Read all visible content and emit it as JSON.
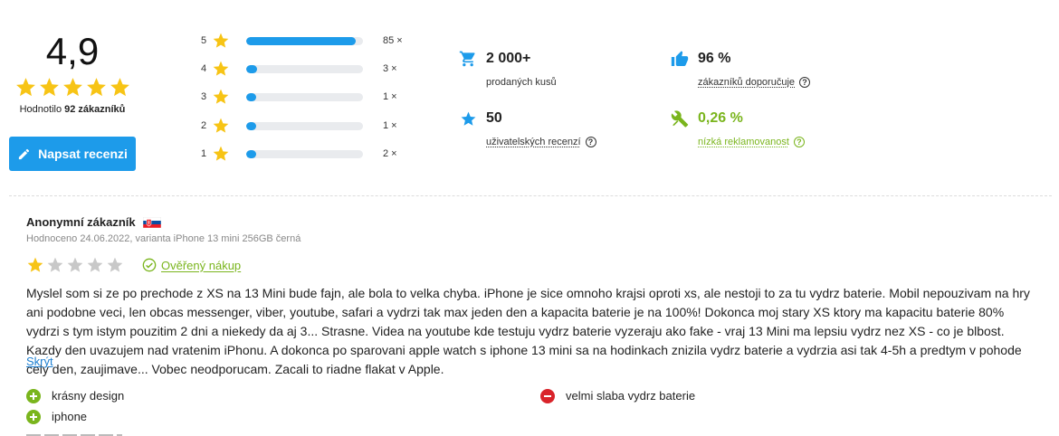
{
  "summary": {
    "score": "4,9",
    "stars_filled": 5,
    "caption_prefix": "Hodnotilo",
    "caption_count": "92 zákazníků",
    "write_button": "Napsat recenzi"
  },
  "histogram": [
    {
      "stars": "5",
      "fraction": 0.94,
      "count": "85 ×"
    },
    {
      "stars": "4",
      "fraction": 0.09,
      "count": "3 ×"
    },
    {
      "stars": "3",
      "fraction": 0.05,
      "count": "1 ×"
    },
    {
      "stars": "2",
      "fraction": 0.05,
      "count": "1 ×"
    },
    {
      "stars": "1",
      "fraction": 0.06,
      "count": "2 ×"
    }
  ],
  "stats": {
    "sold": {
      "value": "2 000+",
      "label": "prodaných kusů",
      "icon": "cart-icon"
    },
    "recommend": {
      "value": "96 %",
      "label": "zákazníků doporučuje",
      "icon": "thumbs-up-icon"
    },
    "reviews": {
      "value": "50",
      "label": "uživatelských recenzí",
      "icon": "star-icon"
    },
    "complaints": {
      "value": "0,26 %",
      "label": "nízká reklamovanost",
      "icon": "tools-icon"
    }
  },
  "review": {
    "author": "Anonymní zákazník",
    "country_flag": "slovakia-flag",
    "meta": "Hodnoceno 24.06.2022, varianta iPhone 13 mini 256GB černá",
    "rating": 1,
    "verified": "Ověřený nákup",
    "text": "Myslel som si ze po prechode z XS na 13 Mini bude fajn, ale bola to velka chyba. iPhone je sice omnoho krajsi oproti xs, ale nestoji to za tu vydrz baterie. Mobil nepouzivam na hry ani podobne veci, len obcas messenger, viber, youtube, safari a vydrzi tak max jeden den a kapacita baterie je na 100%! Dokonca moj stary XS ktory ma kapacitu baterie 80% vydrzi s tym istym pouzitim 2 dni a niekedy da aj 3... Strasne. Videa na youtube kde testuju vydrz baterie vyzeraju ako fake - vraj 13 Mini ma lepsiu vydrz nez XS - co je blbost. Kazdy den uvazujem nad vratenim iPhonu. A dokonca po sparovani apple watch s iphone 13 mini sa na hodinkach znizila vydrz baterie a vydrzia asi tak 4-5h a predtym v pohode cely den, zaujimave... Vobec neodporucam. Zacali to riadne flakat v Apple.",
    "collapse": "Skrýt",
    "pros": [
      "krásny design",
      "iphone"
    ],
    "cons": [
      "velmi slaba vydrz baterie"
    ]
  },
  "colors": {
    "accent": "#1d9bea",
    "star": "#f7c415",
    "star_empty": "#c8c8c8",
    "positive": "#7ab51d",
    "negative": "#d9232a"
  }
}
